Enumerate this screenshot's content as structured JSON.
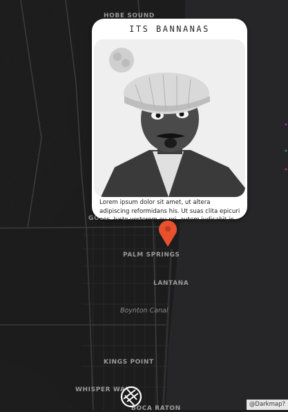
{
  "map": {
    "places": [
      {
        "key": "hobe_sound",
        "label": "HOBE SOUND"
      },
      {
        "key": "golden_lakes",
        "label": "GOLDEN LAKES"
      },
      {
        "key": "palm_springs",
        "label": "PALM SPRINGS"
      },
      {
        "key": "lantana",
        "label": "LANTANA"
      },
      {
        "key": "boynton_canal",
        "label": "Boynton Canal"
      },
      {
        "key": "kings_point",
        "label": "KINGS POINT"
      },
      {
        "key": "whisper_walk",
        "label": "WHISPER WALK"
      },
      {
        "key": "boca_raton",
        "label": "BOCA RATON"
      }
    ],
    "colors": {
      "land": "#1b1b1b",
      "land_west": "#161616",
      "water": "#2a2a2c",
      "roads": "#3a3a3a",
      "marker": "#e8502e"
    }
  },
  "popup": {
    "title": "ITS BANNANAS",
    "photo_icon": "portrait-photo",
    "text": "Lorem ipsum dolor sit amet, ut altera adipiscing reformidans his. Ut suas clita epicuri eos. Justo verterem eu pri, autem iudicabit in mea. Id vel alienum fabellas definitionem, ex usu putant"
  },
  "marker": {
    "icon": "map-pin-icon"
  },
  "controls": {
    "locate_icon": "camera-shutter-icon"
  },
  "attribution": "@Darkmap?"
}
